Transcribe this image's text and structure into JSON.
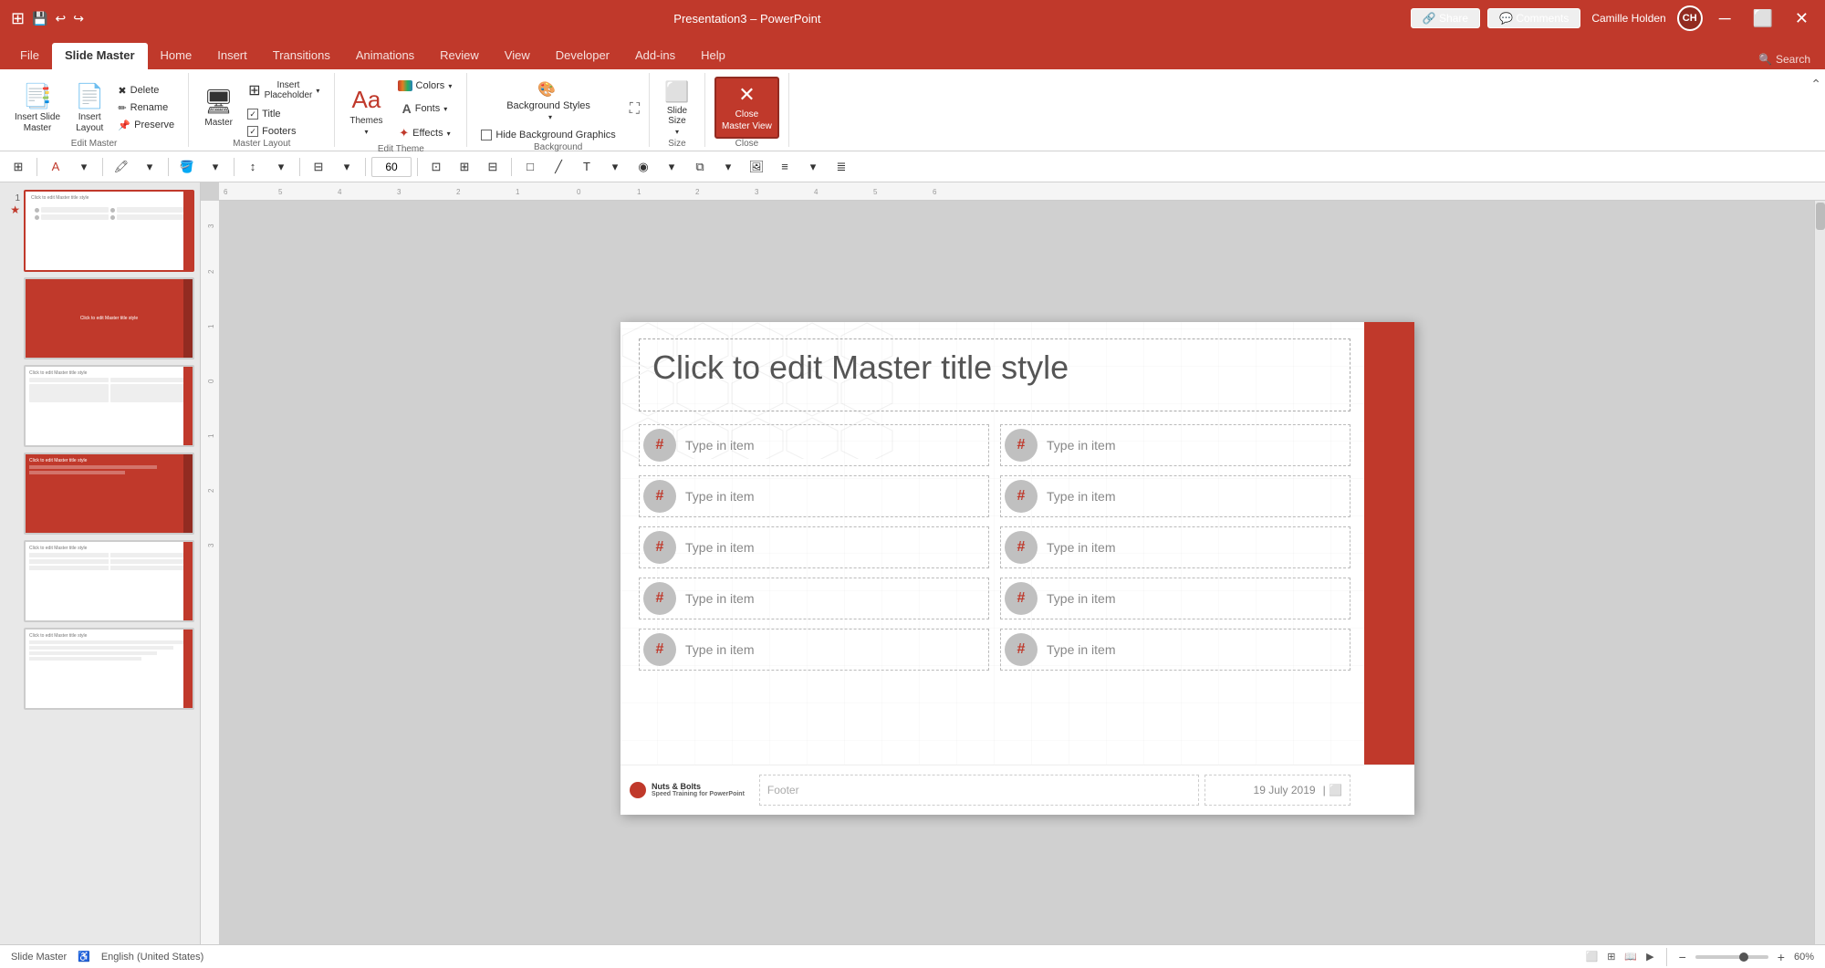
{
  "titlebar": {
    "filename": "Presentation3",
    "app": "PowerPoint",
    "separator": "–",
    "user": "Camille Holden",
    "user_initials": "CH"
  },
  "ribbon_tabs": [
    {
      "id": "file",
      "label": "File"
    },
    {
      "id": "slide-master",
      "label": "Slide Master",
      "active": true
    },
    {
      "id": "home",
      "label": "Home"
    },
    {
      "id": "insert",
      "label": "Insert"
    },
    {
      "id": "transitions",
      "label": "Transitions"
    },
    {
      "id": "animations",
      "label": "Animations"
    },
    {
      "id": "review",
      "label": "Review"
    },
    {
      "id": "view",
      "label": "View"
    },
    {
      "id": "developer",
      "label": "Developer"
    },
    {
      "id": "add-ins",
      "label": "Add-ins"
    },
    {
      "id": "help",
      "label": "Help"
    }
  ],
  "ribbon": {
    "edit_master": {
      "label": "Edit Master",
      "insert_slide_master": "Insert Slide\nMaster",
      "insert_layout": "Insert\nLayout",
      "delete": "Delete",
      "rename": "Rename",
      "preserve": "Preserve"
    },
    "master_layout": {
      "label": "Master Layout",
      "master": "Master",
      "insert_placeholder": "Insert\nPlaceholder",
      "title_checked": true,
      "title_label": "Title",
      "footers_checked": true,
      "footers_label": "Footers"
    },
    "edit_theme": {
      "label": "Edit Theme",
      "themes": "Themes",
      "colors": "Colors",
      "fonts": "Fonts",
      "effects": "Effects"
    },
    "background": {
      "label": "Background",
      "background_styles": "Background Styles",
      "hide_background_graphics": "Hide Background Graphics"
    },
    "size": {
      "label": "Size",
      "slide_size": "Slide\nSize"
    },
    "close": {
      "label": "Close",
      "close_master_view": "Close\nMaster View"
    }
  },
  "slide": {
    "title": "Click to edit Master title style",
    "items": [
      {
        "col": 0,
        "row": 0,
        "hash": "#",
        "text": "Type in item"
      },
      {
        "col": 0,
        "row": 1,
        "hash": "#",
        "text": "Type in item"
      },
      {
        "col": 0,
        "row": 2,
        "hash": "#",
        "text": "Type in item"
      },
      {
        "col": 0,
        "row": 3,
        "hash": "#",
        "text": "Type in item"
      },
      {
        "col": 0,
        "row": 4,
        "hash": "#",
        "text": "Type in item"
      },
      {
        "col": 1,
        "row": 0,
        "hash": "#",
        "text": "Type in item"
      },
      {
        "col": 1,
        "row": 1,
        "hash": "#",
        "text": "Type in item"
      },
      {
        "col": 1,
        "row": 2,
        "hash": "#",
        "text": "Type in item"
      },
      {
        "col": 1,
        "row": 3,
        "hash": "#",
        "text": "Type in item"
      },
      {
        "col": 1,
        "row": 4,
        "hash": "#",
        "text": "Type in item"
      }
    ],
    "footer": {
      "logo_name": "Nuts & Bolts",
      "logo_subtitle": "Speed Training for PowerPoint",
      "footer_text": "Footer",
      "date": "19 July 2019"
    }
  },
  "status_bar": {
    "view": "Slide Master",
    "language": "English (United States)",
    "zoom": "60%",
    "zoom_level": 60
  },
  "toolbar": {
    "zoom_value": "60"
  }
}
